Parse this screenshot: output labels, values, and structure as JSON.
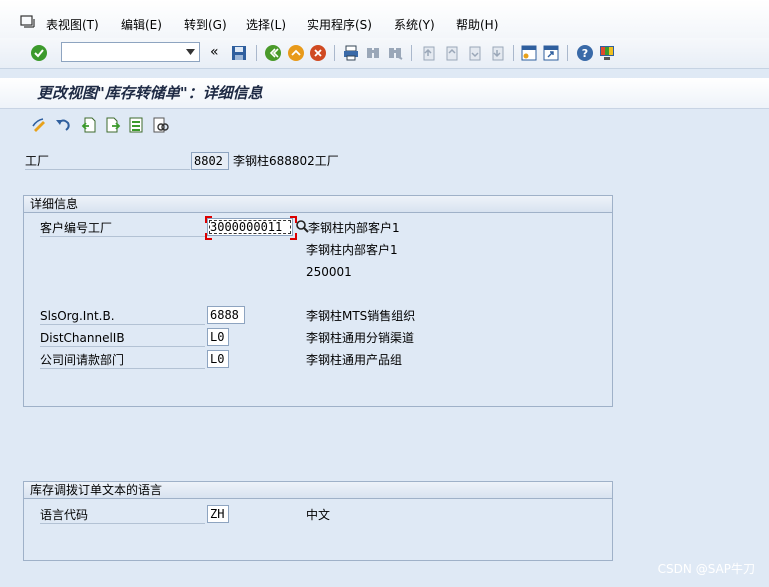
{
  "menu": {
    "items": [
      "表视图(T)",
      "编辑(E)",
      "转到(G)",
      "选择(L)",
      "实用程序(S)",
      "系统(Y)",
      "帮助(H)"
    ]
  },
  "toolbar": {
    "command_value": "",
    "back_glyph": "«"
  },
  "title": "更改视图\"库存转储单\"：详细信息",
  "plant": {
    "label": "工厂",
    "code": "8802",
    "name": "李钢柱688802工厂"
  },
  "details": {
    "header": "详细信息",
    "customer_label": "客户编号工厂",
    "customer_value": "3000000011",
    "customer_name1": "李钢柱内部客户1",
    "customer_name2": "李钢柱内部客户1",
    "customer_code": "250001",
    "salesorg_label": "SlsOrg.Int.B.",
    "salesorg_value": "6888",
    "salesorg_text": "李钢柱MTS销售组织",
    "distch_label": "DistChannelIB",
    "distch_value": "L0",
    "distch_text": "李钢柱通用分销渠道",
    "division_label": "公司间请款部门",
    "division_value": "L0",
    "division_text": "李钢柱通用产品组"
  },
  "language": {
    "header": "库存调拨订单文本的语言",
    "label": "语言代码",
    "value": "ZH",
    "text": "中文"
  },
  "watermark": "CSDN @SAP牛刀"
}
